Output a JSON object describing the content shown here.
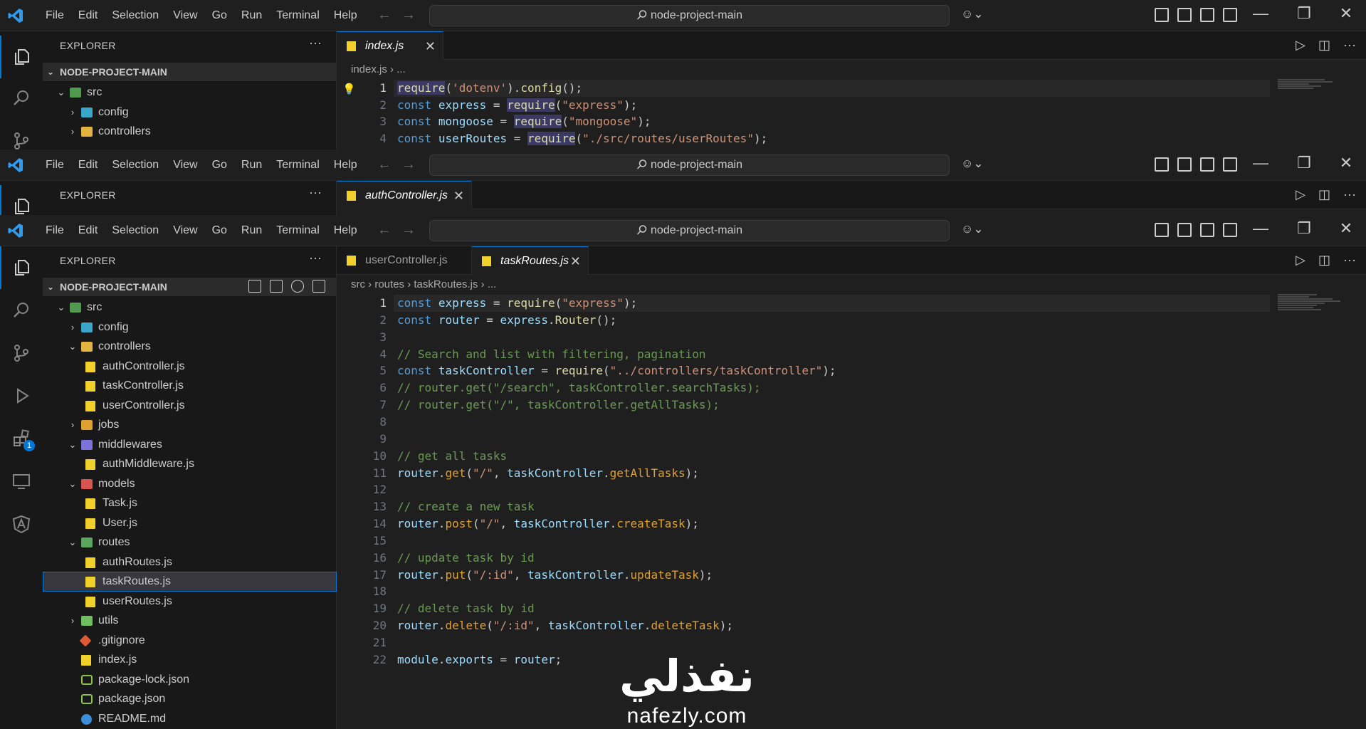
{
  "menu": [
    "File",
    "Edit",
    "Selection",
    "View",
    "Go",
    "Run",
    "Terminal",
    "Help"
  ],
  "search": {
    "label": "node-project-main"
  },
  "sidebar": {
    "title": "EXPLORER",
    "section": "NODE-PROJECT-MAIN",
    "more": "···"
  },
  "window1": {
    "tabs": [
      {
        "label": "index.js"
      }
    ],
    "breadcrumb": [
      "index.js",
      "..."
    ],
    "tree": [
      "src",
      "config",
      "controllers"
    ],
    "lines": [
      {
        "n": "1",
        "html": "<span class=\"f req\">require</span>(<span class=\"s\">'dotenv'</span>).<span class=\"f\">config</span>();"
      },
      {
        "n": "2",
        "html": "<span class=\"k\">const</span> <span class=\"v\">express</span> = <span class=\"f req\">require</span>(<span class=\"s\">\"express\"</span>);"
      },
      {
        "n": "3",
        "html": "<span class=\"k\">const</span> <span class=\"v\">mongoose</span> = <span class=\"f req\">require</span>(<span class=\"s\">\"mongoose\"</span>);"
      },
      {
        "n": "4",
        "html": "<span class=\"k\">const</span> <span class=\"v\">userRoutes</span> = <span class=\"f req\">require</span>(<span class=\"s\">\"./src/routes/userRoutes\"</span>);"
      }
    ]
  },
  "window2": {
    "tabs": [
      {
        "label": "authController.js"
      }
    ]
  },
  "window3": {
    "tabs": [
      {
        "label": "userController.js"
      },
      {
        "label": "taskRoutes.js"
      }
    ],
    "breadcrumb": [
      "src",
      "routes",
      "taskRoutes.js",
      "..."
    ],
    "tree": [
      {
        "label": "src",
        "depth": 0,
        "kind": "folder",
        "icon": "src",
        "open": true
      },
      {
        "label": "config",
        "depth": 1,
        "kind": "folder",
        "icon": "cfg",
        "open": false
      },
      {
        "label": "controllers",
        "depth": 1,
        "kind": "folder",
        "icon": "ctl",
        "open": true
      },
      {
        "label": "authController.js",
        "depth": 2,
        "kind": "file",
        "icon": "js"
      },
      {
        "label": "taskController.js",
        "depth": 2,
        "kind": "file",
        "icon": "js"
      },
      {
        "label": "userController.js",
        "depth": 2,
        "kind": "file",
        "icon": "js"
      },
      {
        "label": "jobs",
        "depth": 1,
        "kind": "folder",
        "icon": "jobs",
        "open": false
      },
      {
        "label": "middlewares",
        "depth": 1,
        "kind": "folder",
        "icon": "mw",
        "open": true
      },
      {
        "label": "authMiddleware.js",
        "depth": 2,
        "kind": "file",
        "icon": "js"
      },
      {
        "label": "models",
        "depth": 1,
        "kind": "folder",
        "icon": "mdl",
        "open": true
      },
      {
        "label": "Task.js",
        "depth": 2,
        "kind": "file",
        "icon": "js"
      },
      {
        "label": "User.js",
        "depth": 2,
        "kind": "file",
        "icon": "js"
      },
      {
        "label": "routes",
        "depth": 1,
        "kind": "folder",
        "icon": "rt",
        "open": true
      },
      {
        "label": "authRoutes.js",
        "depth": 2,
        "kind": "file",
        "icon": "js"
      },
      {
        "label": "taskRoutes.js",
        "depth": 2,
        "kind": "file",
        "icon": "js",
        "selected": true
      },
      {
        "label": "userRoutes.js",
        "depth": 2,
        "kind": "file",
        "icon": "js"
      },
      {
        "label": "utils",
        "depth": 1,
        "kind": "folder",
        "icon": "utl",
        "open": false
      },
      {
        "label": ".gitignore",
        "depth": 1,
        "kind": "file",
        "icon": "git"
      },
      {
        "label": "index.js",
        "depth": 1,
        "kind": "file",
        "icon": "js"
      },
      {
        "label": "package-lock.json",
        "depth": 1,
        "kind": "file",
        "icon": "json"
      },
      {
        "label": "package.json",
        "depth": 1,
        "kind": "file",
        "icon": "json"
      },
      {
        "label": "README.md",
        "depth": 1,
        "kind": "file",
        "icon": "info"
      }
    ],
    "lines": [
      {
        "n": "1",
        "html": "<span class=\"k\">const</span> <span class=\"v\">express</span> = <span class=\"f\">require</span>(<span class=\"s\">\"express\"</span>);"
      },
      {
        "n": "2",
        "html": "<span class=\"k\">const</span> <span class=\"v\">router</span> = <span class=\"v\">express</span>.<span class=\"f\">Router</span>();"
      },
      {
        "n": "3",
        "html": ""
      },
      {
        "n": "4",
        "html": "<span class=\"c\">// Search and list with filtering, pagination</span>"
      },
      {
        "n": "5",
        "html": "<span class=\"k\">const</span> <span class=\"v\">taskController</span> = <span class=\"f\">require</span>(<span class=\"s\">\"../controllers/taskController\"</span>);"
      },
      {
        "n": "6",
        "html": "<span class=\"c\">// router.get(\"/search\", taskController.searchTasks);</span>"
      },
      {
        "n": "7",
        "html": "<span class=\"c\">// router.get(\"/\", taskController.getAllTasks);</span>"
      },
      {
        "n": "8",
        "html": ""
      },
      {
        "n": "9",
        "html": ""
      },
      {
        "n": "10",
        "html": "<span class=\"c\">// get all tasks</span>"
      },
      {
        "n": "11",
        "html": "<span class=\"v\">router</span>.<span class=\"fo\">get</span>(<span class=\"s\">\"/\"</span>, <span class=\"v\">taskController</span>.<span class=\"fo\">getAllTasks</span>);"
      },
      {
        "n": "12",
        "html": ""
      },
      {
        "n": "13",
        "html": "<span class=\"c\">// create a new task</span>"
      },
      {
        "n": "14",
        "html": "<span class=\"v\">router</span>.<span class=\"fo\">post</span>(<span class=\"s\">\"/\"</span>, <span class=\"v\">taskController</span>.<span class=\"fo\">createTask</span>);"
      },
      {
        "n": "15",
        "html": ""
      },
      {
        "n": "16",
        "html": "<span class=\"c\">// update task by id</span>"
      },
      {
        "n": "17",
        "html": "<span class=\"v\">router</span>.<span class=\"fo\">put</span>(<span class=\"s\">\"/:id\"</span>, <span class=\"v\">taskController</span>.<span class=\"fo\">updateTask</span>);"
      },
      {
        "n": "18",
        "html": ""
      },
      {
        "n": "19",
        "html": "<span class=\"c\">// delete task by id</span>"
      },
      {
        "n": "20",
        "html": "<span class=\"v\">router</span>.<span class=\"fo\">delete</span>(<span class=\"s\">\"/:id\"</span>, <span class=\"v\">taskController</span>.<span class=\"fo\">deleteTask</span>);"
      },
      {
        "n": "21",
        "html": ""
      },
      {
        "n": "22",
        "html": "<span class=\"v\">module</span>.<span class=\"v\">exports</span> = <span class=\"v\">router</span>;"
      }
    ]
  },
  "watermark": {
    "arabic": "نفذلي",
    "latin": "nafezly.com"
  },
  "activity_badge": "1"
}
